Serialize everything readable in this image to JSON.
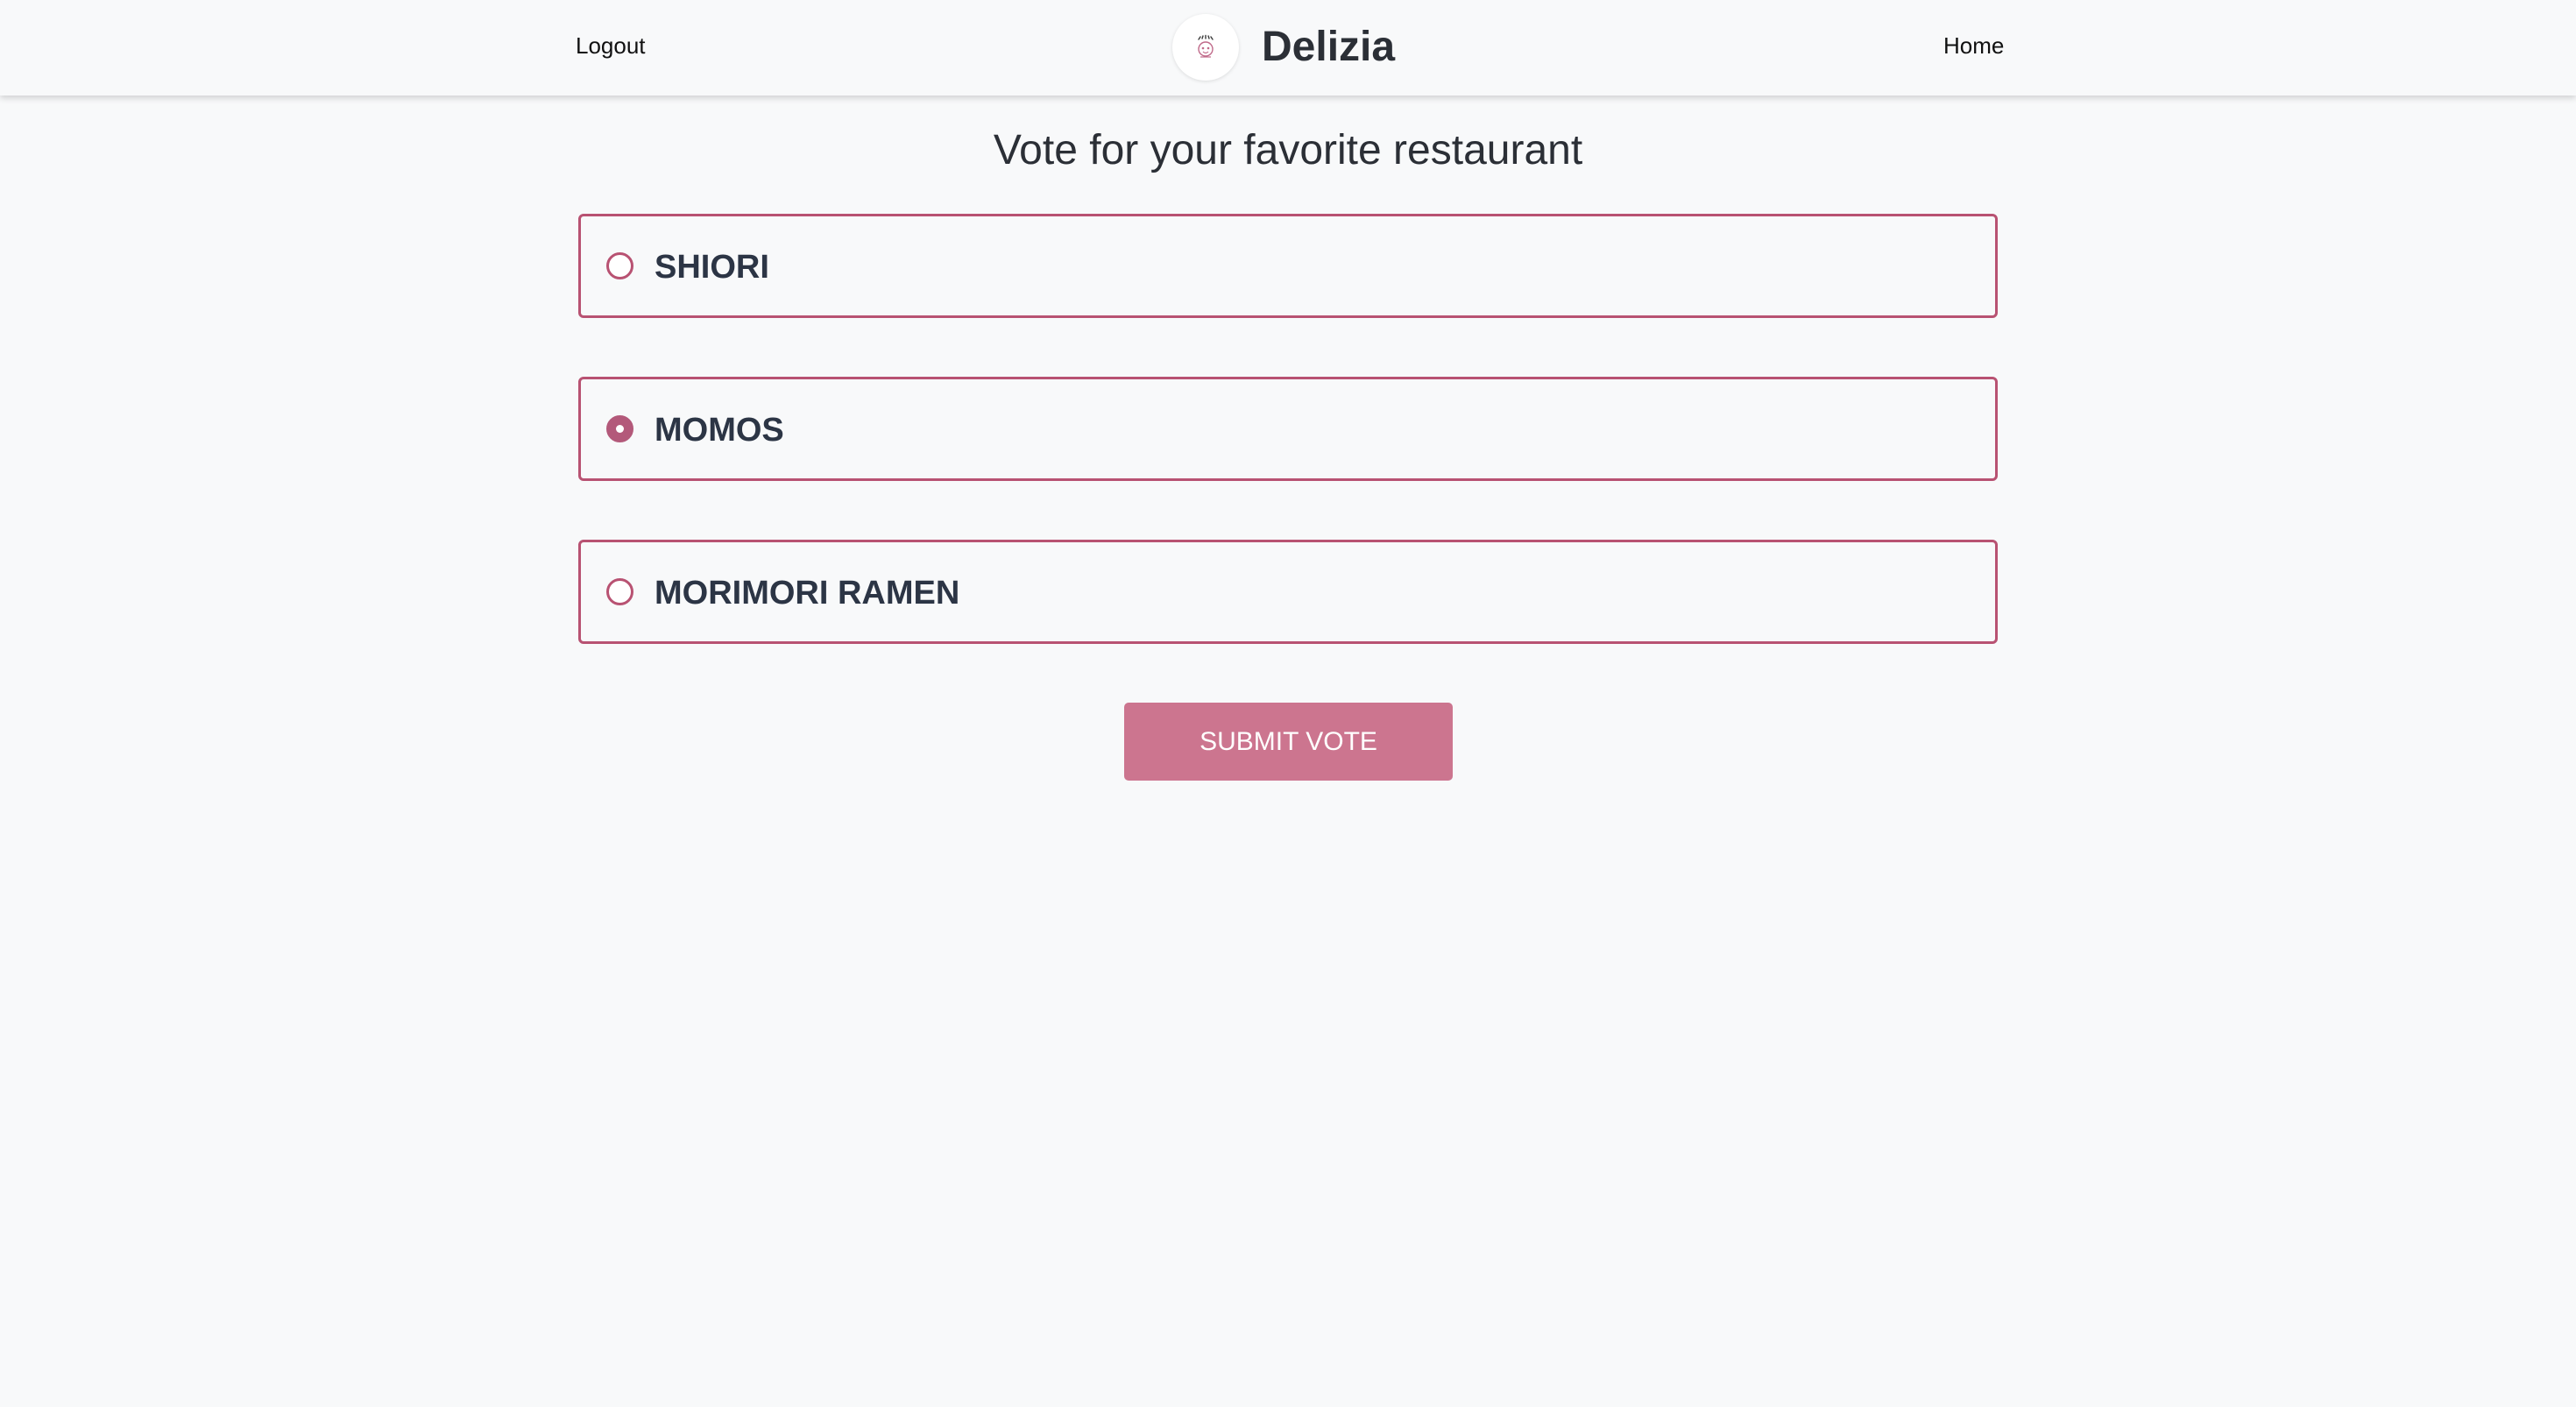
{
  "navbar": {
    "logout_label": "Logout",
    "brand_name": "Delizia",
    "home_label": "Home",
    "logo_icon": "restaurant-logo-icon"
  },
  "main": {
    "title": "Vote for your favorite restaurant",
    "options": [
      {
        "label": "SHIORI",
        "selected": false
      },
      {
        "label": "MOMOS",
        "selected": true
      },
      {
        "label": "MORIMORI RAMEN",
        "selected": false
      }
    ],
    "submit_label": "SUBMIT VOTE"
  },
  "colors": {
    "accent": "#b85272",
    "radio_checked": "#b3597a",
    "button": "#cc758f",
    "background": "#f8f9fa",
    "text": "#2c3545"
  }
}
